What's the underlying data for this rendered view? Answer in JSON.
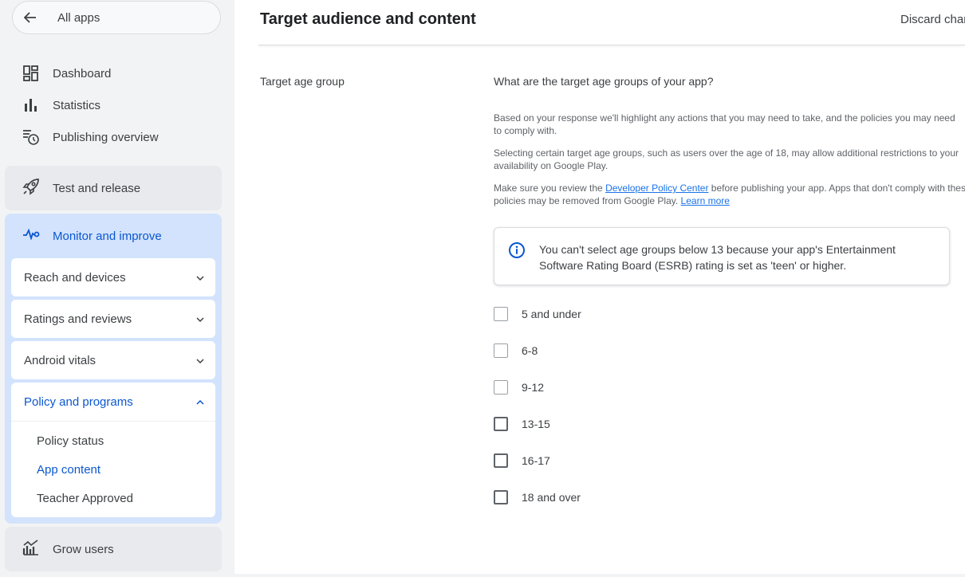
{
  "sidebar": {
    "all_apps": "All apps",
    "nav": [
      {
        "label": "Dashboard",
        "icon": "dashboard-icon"
      },
      {
        "label": "Statistics",
        "icon": "bar-chart-icon"
      },
      {
        "label": "Publishing overview",
        "icon": "schedule-list-icon"
      }
    ],
    "test_release": "Test and release",
    "monitor": {
      "label": "Monitor and improve",
      "items": [
        {
          "label": "Reach and devices"
        },
        {
          "label": "Ratings and reviews"
        },
        {
          "label": "Android vitals"
        }
      ],
      "policy": {
        "label": "Policy and programs",
        "sub": [
          {
            "label": "Policy status"
          },
          {
            "label": "App content"
          },
          {
            "label": "Teacher Approved"
          }
        ]
      }
    },
    "grow": "Grow users"
  },
  "header": {
    "title": "Target audience and content",
    "discard": "Discard changes"
  },
  "form": {
    "label": "Target age group",
    "question": "What are the target age groups of your app?",
    "p1": "Based on your response we'll highlight any actions that you may need to take, and the policies you may need to comply with.",
    "p2": "Selecting certain target age groups, such as users over the age of 18, may allow additional restrictions to your availability on Google Play.",
    "p3_before": "Make sure you review the ",
    "p3_link": "Developer Policy Center",
    "p3_after": " before publishing your app. Apps that don't comply with these policies may be removed from Google Play. ",
    "p3_learn": "Learn more",
    "info": "You can't select age groups below 13 because your app's Entertainment Software Rating Board (ESRB) rating is set as 'teen' or higher.",
    "age_groups": [
      {
        "label": "5 and under",
        "disabled": true
      },
      {
        "label": "6-8",
        "disabled": true
      },
      {
        "label": "9-12",
        "disabled": true
      },
      {
        "label": "13-15",
        "disabled": false
      },
      {
        "label": "16-17",
        "disabled": false
      },
      {
        "label": "18 and over",
        "disabled": false
      }
    ]
  },
  "colors": {
    "accent": "#0b57d0",
    "selected_bg": "#d3e3fd",
    "link": "#1a73e8"
  }
}
